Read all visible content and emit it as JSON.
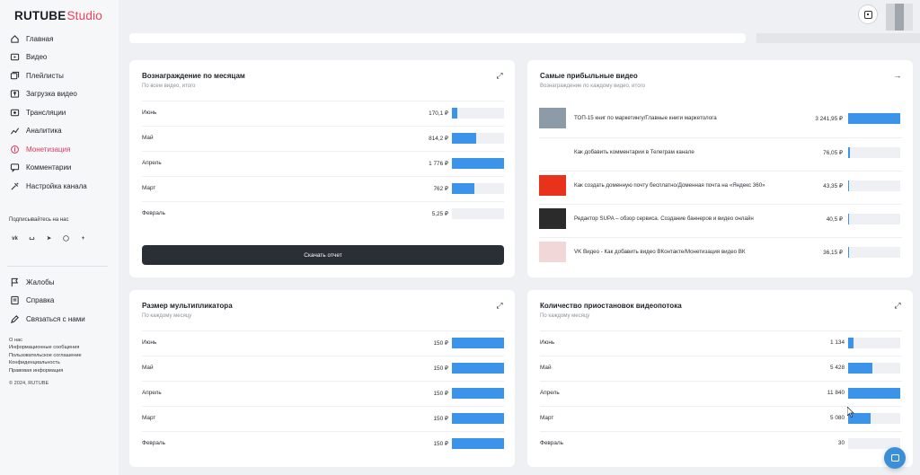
{
  "logo": {
    "main": "RUTUBE",
    "sub": "Studio"
  },
  "sidebar": {
    "items": [
      {
        "label": "Главная",
        "icon": "home-icon",
        "active": false
      },
      {
        "label": "Видео",
        "icon": "video-icon",
        "active": false
      },
      {
        "label": "Плейлисты",
        "icon": "playlist-icon",
        "active": false
      },
      {
        "label": "Загрузка видео",
        "icon": "upload-icon",
        "active": false
      },
      {
        "label": "Трансляции",
        "icon": "broadcast-icon",
        "active": false
      },
      {
        "label": "Аналитика",
        "icon": "analytics-icon",
        "active": false
      },
      {
        "label": "Монетизация",
        "icon": "monetization-icon",
        "active": true
      },
      {
        "label": "Комментарии",
        "icon": "comments-icon",
        "active": false
      },
      {
        "label": "Настройка канала",
        "icon": "settings-icon",
        "active": false
      }
    ],
    "subscribe_label": "Подписывайтесь на нас",
    "socials": [
      "vk",
      "ok",
      "tg",
      "wa",
      "+"
    ],
    "secondary": [
      {
        "label": "Жалобы",
        "icon": "flag-icon"
      },
      {
        "label": "Справка",
        "icon": "help-icon"
      },
      {
        "label": "Связаться с нами",
        "icon": "contact-icon"
      }
    ],
    "links": [
      "О нас",
      "Информационные сообщения",
      "Пользовательское соглашение",
      "Конфиденциальность",
      "Правовая информация"
    ],
    "copyright": "© 2024, RUTUBE"
  },
  "colors": {
    "accent": "#3b93ea",
    "active": "#e2385a",
    "button": "#2a2e35"
  },
  "cards": {
    "rewards": {
      "title": "Вознаграждение по месяцам",
      "subtitle": "По всем видео, итого",
      "rows": [
        {
          "label": "Июнь",
          "value": "170,1 ₽",
          "fraction": 0.1
        },
        {
          "label": "Май",
          "value": "814,2 ₽",
          "fraction": 0.46
        },
        {
          "label": "Апрель",
          "value": "1 776 ₽",
          "fraction": 1.0
        },
        {
          "label": "Март",
          "value": "762 ₽",
          "fraction": 0.43
        },
        {
          "label": "Февраль",
          "value": "5,25 ₽",
          "fraction": 0.0
        }
      ],
      "button": "Скачать отчет"
    },
    "profitable": {
      "title": "Самые прибыльные видео",
      "subtitle": "Вознаграждение по каждому видео, итого",
      "rows": [
        {
          "title": "ТОП-15 книг по маркетингу/Главные книги маркетолога",
          "value": "3 241,95 ₽",
          "fraction": 1.0,
          "thumb": "#8d9aa8"
        },
        {
          "title": "Как добавить комментарии в Телеграм канале",
          "value": "76,05 ₽",
          "fraction": 0.03,
          "thumb": ""
        },
        {
          "title": "Как создать доменную почту бесплатно/Доменная почта на «Яндекс 360»",
          "value": "43,35 ₽",
          "fraction": 0.02,
          "thumb": "#e8321c"
        },
        {
          "title": "Редактор SUPA – обзор сервиса. Создание баннеров и видео онлайн",
          "value": "40,5 ₽",
          "fraction": 0.02,
          "thumb": "#2b2b2b"
        },
        {
          "title": "VK Видео - Как добавить видео ВКонтакте/Монетизация видео ВК",
          "value": "36,15 ₽",
          "fraction": 0.01,
          "thumb": "#f1d7d7"
        }
      ]
    },
    "multiplier": {
      "title": "Размер мультипликатора",
      "subtitle": "По каждому месяцу",
      "rows": [
        {
          "label": "Июнь",
          "value": "150 ₽",
          "fraction": 1.0
        },
        {
          "label": "Май",
          "value": "150 ₽",
          "fraction": 1.0
        },
        {
          "label": "Апрель",
          "value": "150 ₽",
          "fraction": 1.0
        },
        {
          "label": "Март",
          "value": "150 ₽",
          "fraction": 1.0
        },
        {
          "label": "Февраль",
          "value": "150 ₽",
          "fraction": 1.0
        }
      ]
    },
    "prerolls": {
      "title": "Количество приостановок видеопотока",
      "subtitle": "По каждому месяцу",
      "rows": [
        {
          "label": "Июнь",
          "value": "1 134",
          "fraction": 0.1
        },
        {
          "label": "Май",
          "value": "5 428",
          "fraction": 0.46
        },
        {
          "label": "Апрель",
          "value": "11 840",
          "fraction": 1.0
        },
        {
          "label": "Март",
          "value": "5 080",
          "fraction": 0.43
        },
        {
          "label": "Февраль",
          "value": "30",
          "fraction": 0.0
        }
      ]
    }
  }
}
